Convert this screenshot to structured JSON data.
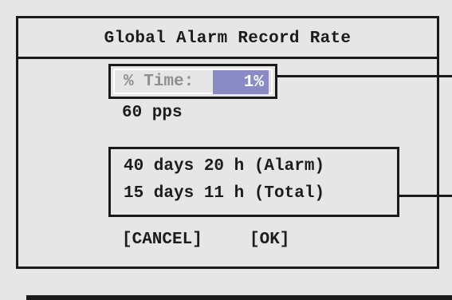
{
  "dialog": {
    "title": "Global Alarm Record Rate",
    "percent_time": {
      "label": "% Time:",
      "value": "1%"
    },
    "rate": "60 pps",
    "storage": {
      "alarm": "40 days 20 h (Alarm)",
      "total": "15 days 11 h (Total)"
    },
    "buttons": {
      "cancel": "[CANCEL]",
      "ok": "[OK]"
    }
  },
  "colors": {
    "background": "#e6e6e6",
    "border": "#1a1a1a",
    "highlight": "#8a8ac4",
    "label_dim": "#8f8f8f"
  }
}
